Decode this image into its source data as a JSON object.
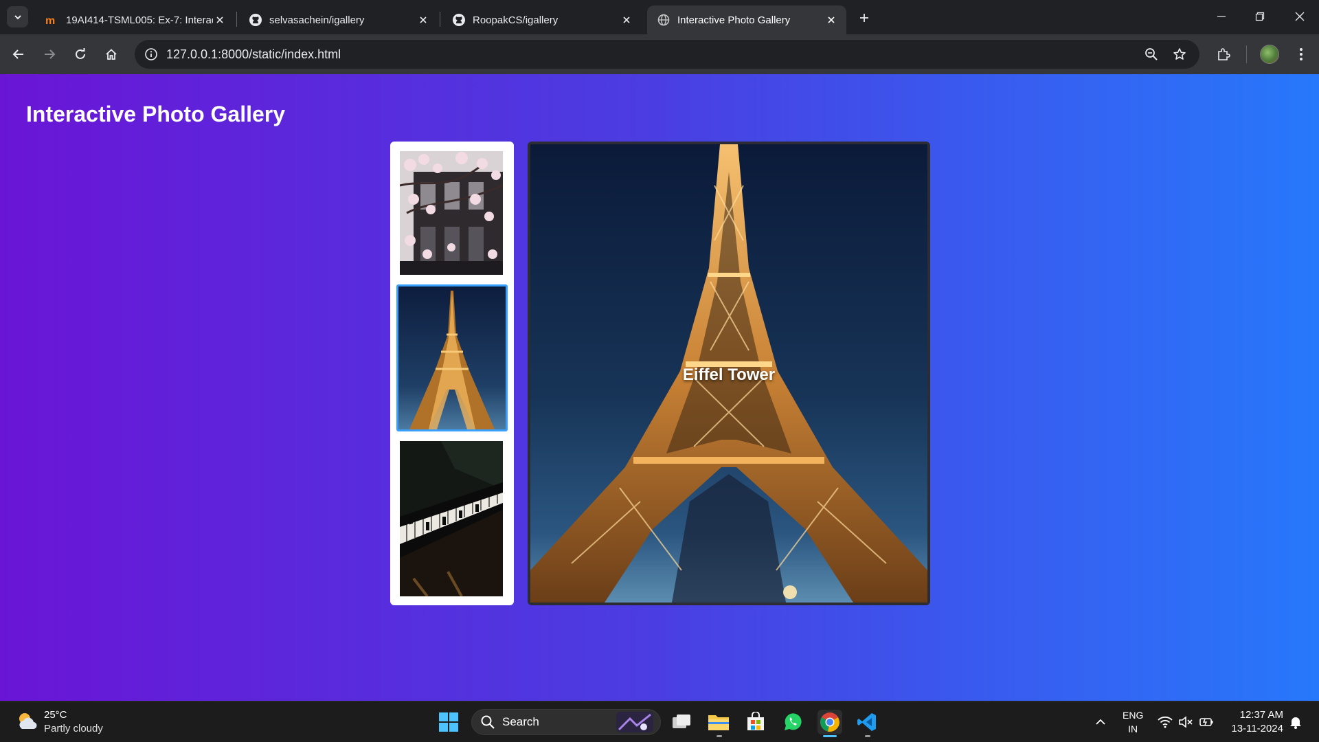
{
  "browser": {
    "tabs": [
      {
        "title": "19AI414-TSML005: Ex-7: Interac",
        "icon": "moodle-icon",
        "active": false
      },
      {
        "title": "selvasachein/igallery",
        "icon": "github-icon",
        "active": false
      },
      {
        "title": "RoopakCS/igallery",
        "icon": "github-icon",
        "active": false
      },
      {
        "title": "Interactive Photo Gallery",
        "icon": "globe-icon",
        "active": true
      }
    ],
    "url": "127.0.0.1:8000/static/index.html"
  },
  "page": {
    "title": "Interactive Photo Gallery",
    "thumbnails": [
      {
        "subject": "cherry blossom building",
        "selected": false
      },
      {
        "subject": "Eiffel Tower",
        "selected": true
      },
      {
        "subject": "piano",
        "selected": false
      }
    ],
    "main_caption": "Eiffel Tower"
  },
  "taskbar": {
    "weather_temp": "25°C",
    "weather_desc": "Partly cloudy",
    "search_label": "Search",
    "lang_top": "ENG",
    "lang_bottom": "IN",
    "time": "12:37 AM",
    "date": "13-11-2024"
  },
  "colors": {
    "gradient_start": "#6a15d6",
    "gradient_end": "#2778fb",
    "thumb_selected_border": "#3aa0ff"
  }
}
